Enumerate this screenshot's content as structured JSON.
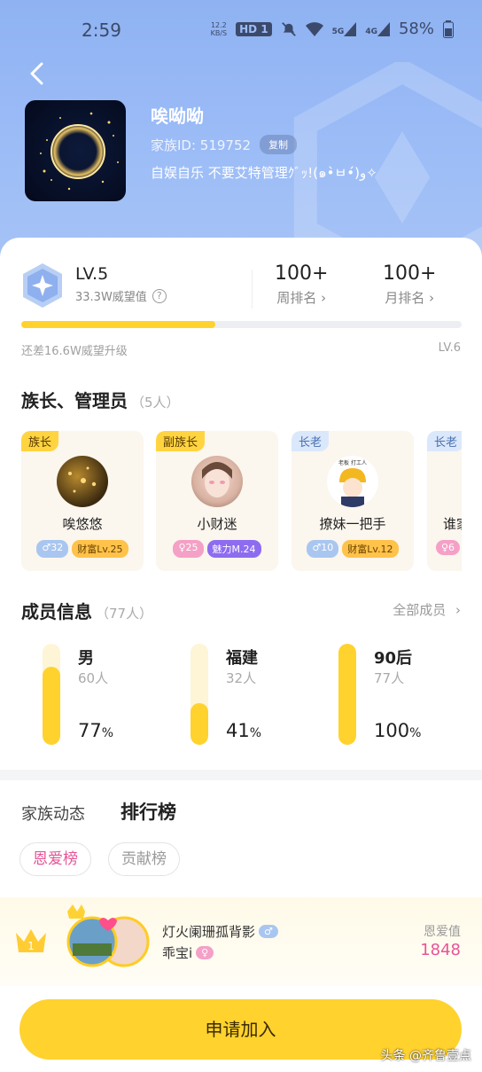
{
  "status_bar": {
    "time": "2:59",
    "speed": "12.2",
    "speed_unit": "KB/S",
    "hd": "HD",
    "hd_sub": "1",
    "net5g": "5G",
    "net4g": "4G",
    "battery": "58%"
  },
  "family": {
    "name": "唉呦呦",
    "id_label": "家族ID: 519752",
    "copy_label": "复制",
    "desc": "自娱自乐 不要艾特管理ｸﾞｯ!(๑•̀ㅂ•́)و✧"
  },
  "level": {
    "label": "LV.5",
    "prestige": "33.3W威望值",
    "help": "?",
    "progress": 0.44,
    "remaining": "还差16.6W威望升级",
    "next": "LV.6"
  },
  "ranks": {
    "weekly_value": "100+",
    "weekly_label": "周排名",
    "monthly_value": "100+",
    "monthly_label": "月排名"
  },
  "admins": {
    "title": "族长、管理员",
    "count": "（5人）",
    "items": [
      {
        "role": "族长",
        "name": "唉悠悠",
        "gender_tag": "♂32",
        "level_tag": "财富Lv.25"
      },
      {
        "role": "副族长",
        "name": "小财迷",
        "gender_tag": "♀25",
        "level_tag": "魅力M.24"
      },
      {
        "role": "长老",
        "name": "撩妹一把手",
        "gender_tag": "♂10",
        "level_tag": "财富Lv.12",
        "avatar_text": "老板 打工人"
      },
      {
        "role": "长老",
        "name": "谁家",
        "gender_tag": "♀6",
        "level_tag": ""
      }
    ]
  },
  "members": {
    "title": "成员信息",
    "count": "（77人）",
    "all_label": "全部成员",
    "stats": [
      {
        "name": "男",
        "count": "60人",
        "pct": "77",
        "unit": "%",
        "fill": 0.77
      },
      {
        "name": "福建",
        "count": "32人",
        "pct": "41",
        "unit": "%",
        "fill": 0.41
      },
      {
        "name": "90后",
        "count": "77人",
        "pct": "100",
        "unit": "%",
        "fill": 1.0
      }
    ]
  },
  "tabs": {
    "dynamic": "家族动态",
    "leaderboard": "排行榜",
    "love": "恩爱榜",
    "contribute": "贡献榜"
  },
  "top_rank": {
    "position": "1",
    "name": "灯火阑珊孤背影",
    "name_tag": "♂",
    "partner": "乖宝i",
    "partner_tag": "♀",
    "metric_label": "恩爱值",
    "metric_value": "1848"
  },
  "join_label": "申请加入",
  "watermark": "头条 @齐鲁壹点"
}
